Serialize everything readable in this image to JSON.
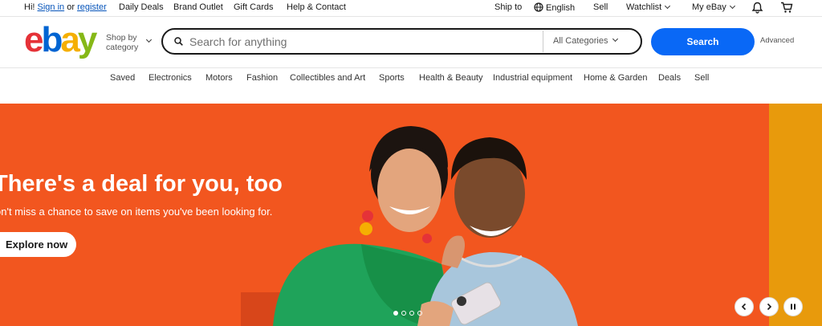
{
  "topbar": {
    "greeting": "Hi!",
    "sign_in": "Sign in",
    "or": "or",
    "register": "register",
    "daily_deals": "Daily Deals",
    "brand_outlet": "Brand Outlet",
    "gift_cards": "Gift Cards",
    "help_contact": "Help & Contact",
    "ship_to": "Ship to",
    "language": "English",
    "sell": "Sell",
    "watchlist": "Watchlist",
    "my_ebay": "My eBay"
  },
  "header": {
    "logo": {
      "e": "e",
      "b": "b",
      "a": "a",
      "y": "y"
    },
    "shop_by_line1": "Shop by",
    "shop_by_line2": "category",
    "search_placeholder": "Search for anything",
    "category_selected": "All Categories",
    "search_button": "Search",
    "advanced": "Advanced"
  },
  "nav": [
    "Saved",
    "Electronics",
    "Motors",
    "Fashion",
    "Collectibles and Art",
    "Sports",
    "Health & Beauty",
    "Industrial equipment",
    "Home & Garden",
    "Deals",
    "Sell"
  ],
  "hero": {
    "title": "There's a deal for you, too",
    "subtitle": "on't miss a chance to save on items you've been looking for.",
    "cta": "Explore now",
    "background_color": "#f2561f",
    "side_color": "#e89a0c"
  },
  "colors": {
    "accent": "#0968f6",
    "link": "#0654ba"
  }
}
